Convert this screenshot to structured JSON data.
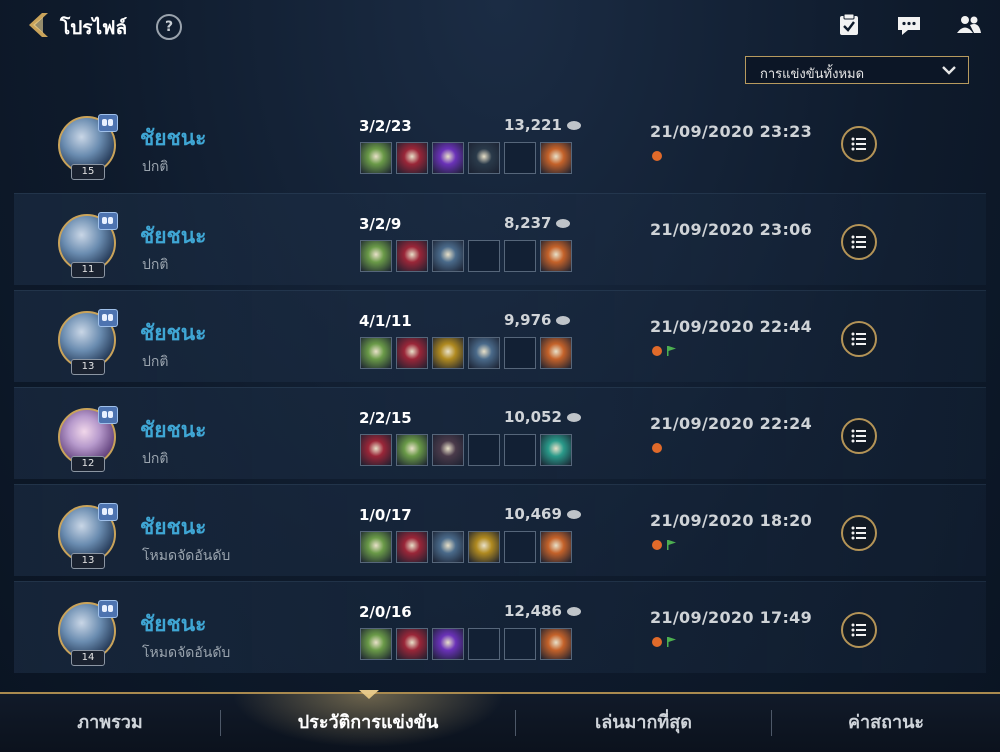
{
  "header": {
    "title": "โปรไฟล์",
    "help_label": "?",
    "filter": {
      "selected": "การแข่งขันทั้งหมด"
    }
  },
  "matches": [
    {
      "hero": "ชัยชนะ",
      "mode": "ปกติ",
      "level": "15",
      "kda": "3/2/23",
      "gold": "13,221",
      "date": "21/09/2020 23:23",
      "items": [
        "#6a9a48",
        "#9a2638",
        "#6a32b8",
        "#2a3a4a",
        null,
        "#c4622a"
      ],
      "medal": true,
      "flag": false,
      "avatar": "blue"
    },
    {
      "hero": "ชัยชนะ",
      "mode": "ปกติ",
      "level": "11",
      "kda": "3/2/9",
      "gold": "8,237",
      "date": "21/09/2020 23:06",
      "items": [
        "#6a9a48",
        "#9a2638",
        "#4a6a8a",
        null,
        null,
        "#c4622a"
      ],
      "medal": false,
      "flag": false,
      "avatar": "blue"
    },
    {
      "hero": "ชัยชนะ",
      "mode": "ปกติ",
      "level": "13",
      "kda": "4/1/11",
      "gold": "9,976",
      "date": "21/09/2020 22:44",
      "items": [
        "#6a9a48",
        "#9a2638",
        "#b08a20",
        "#4a6a8a",
        null,
        "#c4622a"
      ],
      "medal": true,
      "flag": true,
      "avatar": "blue"
    },
    {
      "hero": "ชัยชนะ",
      "mode": "ปกติ",
      "level": "12",
      "kda": "2/2/15",
      "gold": "10,052",
      "date": "21/09/2020 22:24",
      "items": [
        "#9a2638",
        "#6a9a48",
        "#4a3a4a",
        null,
        null,
        "#2a9a8a"
      ],
      "medal": true,
      "flag": false,
      "avatar": "purple"
    },
    {
      "hero": "ชัยชนะ",
      "mode": "โหมดจัดอันดับ",
      "level": "13",
      "kda": "1/0/17",
      "gold": "10,469",
      "date": "21/09/2020 18:20",
      "items": [
        "#6a9a48",
        "#9a2638",
        "#4a6a8a",
        "#b08a20",
        null,
        "#c4622a"
      ],
      "medal": true,
      "flag": true,
      "avatar": "blue"
    },
    {
      "hero": "ชัยชนะ",
      "mode": "โหมดจัดอันดับ",
      "level": "14",
      "kda": "2/0/16",
      "gold": "12,486",
      "date": "21/09/2020 17:49",
      "items": [
        "#6a9a48",
        "#9a2638",
        "#6a32b8",
        null,
        null,
        "#c4622a"
      ],
      "medal": true,
      "flag": true,
      "avatar": "blue"
    }
  ],
  "bottom_nav": {
    "tabs": [
      {
        "label": "ภาพรวม",
        "active": false
      },
      {
        "label": "ประวัติการแข่งขัน",
        "active": true
      },
      {
        "label": "เล่นมากที่สุด",
        "active": false
      },
      {
        "label": "ค่าสถานะ",
        "active": false
      }
    ]
  },
  "colors": {
    "accent_gold": "#b49457",
    "hero_name": "#3fa6d4",
    "medal": "#e06a2a",
    "flag": "#4caf50"
  }
}
